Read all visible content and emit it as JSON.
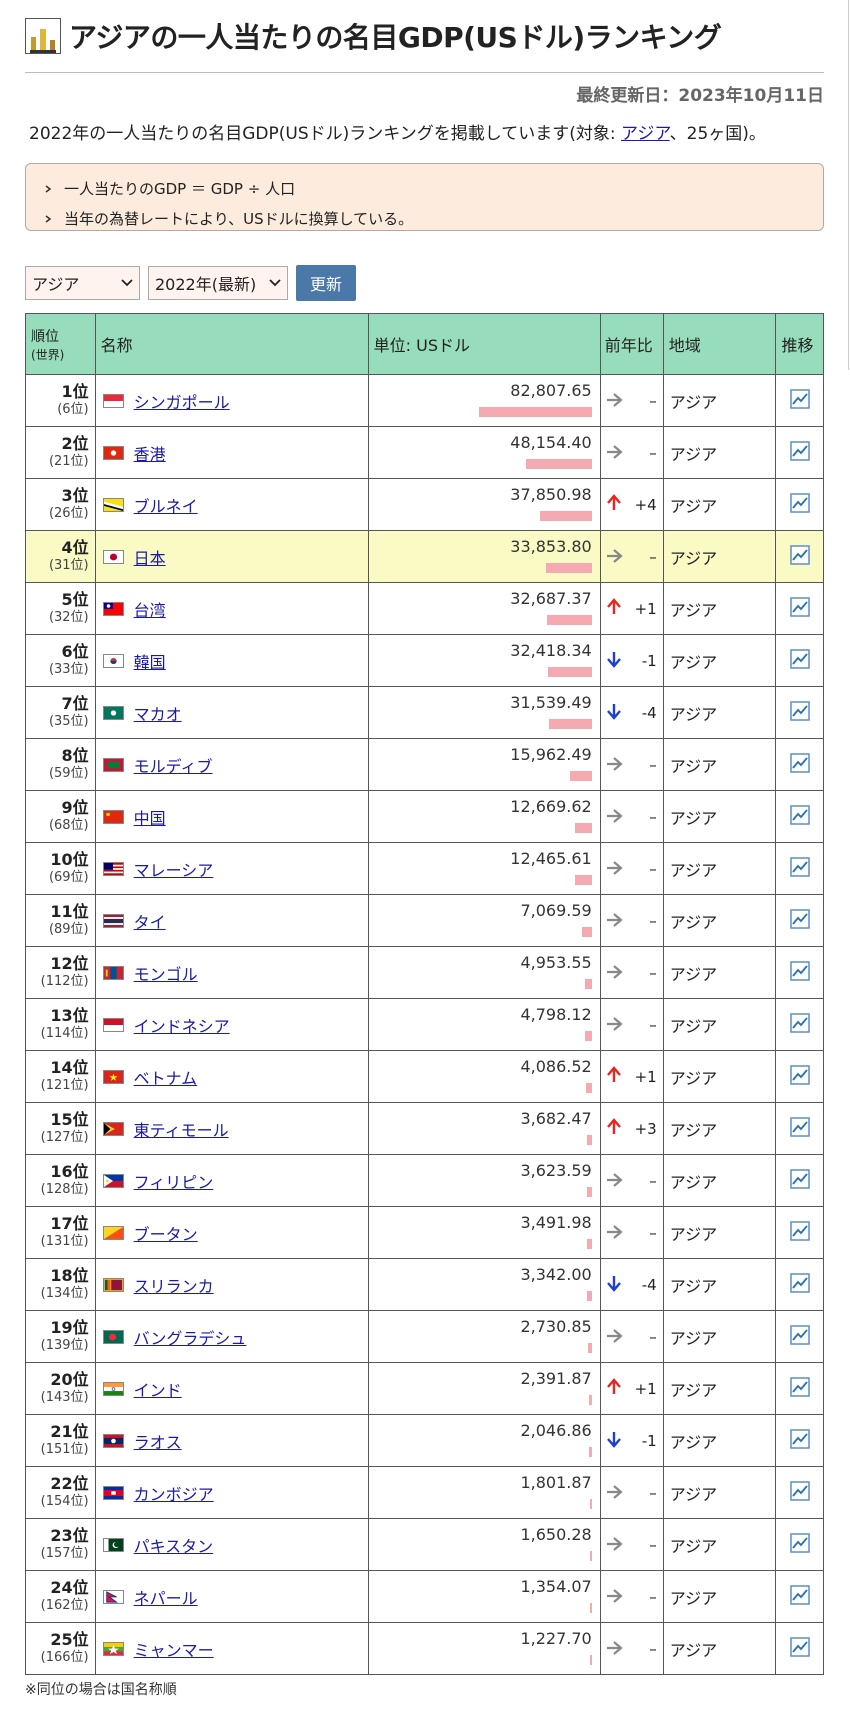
{
  "page": {
    "title": "アジアの一人当たりの名目GDP(USドル)ランキング",
    "updated": "最終更新日：2023年10月11日",
    "desc_prefix": "2022年の一人当たりの名目GDP(USドル)ランキングを掲載しています(対象: ",
    "desc_link": "アジア",
    "desc_suffix": "、25ヶ国)。",
    "notes": [
      "一人当たりのGDP ＝ GDP ÷ 人口",
      "当年の為替レートにより、USドルに換算している。"
    ],
    "footnote": "※同位の場合は国名称順"
  },
  "controls": {
    "region_select": "アジア",
    "year_select": "2022年(最新)",
    "update_button": "更新"
  },
  "table": {
    "headers": {
      "rank": "順位",
      "rank_sub": "(世界)",
      "name": "名称",
      "unit": "単位: USドル",
      "change": "前年比",
      "region": "地域",
      "trend": "推移"
    },
    "rows": [
      {
        "rank": "1位",
        "world": "(6位)",
        "name": "シンガポール",
        "value": "82,807.65",
        "dir": "flat",
        "change": "–",
        "region": "アジア",
        "flag": "sg"
      },
      {
        "rank": "2位",
        "world": "(21位)",
        "name": "香港",
        "value": "48,154.40",
        "dir": "flat",
        "change": "–",
        "region": "アジア",
        "flag": "hk"
      },
      {
        "rank": "3位",
        "world": "(26位)",
        "name": "ブルネイ",
        "value": "37,850.98",
        "dir": "up",
        "change": "+4",
        "region": "アジア",
        "flag": "bn"
      },
      {
        "rank": "4位",
        "world": "(31位)",
        "name": "日本",
        "value": "33,853.80",
        "dir": "flat",
        "change": "–",
        "region": "アジア",
        "flag": "jp",
        "highlight": true
      },
      {
        "rank": "5位",
        "world": "(32位)",
        "name": "台湾",
        "value": "32,687.37",
        "dir": "up",
        "change": "+1",
        "region": "アジア",
        "flag": "tw"
      },
      {
        "rank": "6位",
        "world": "(33位)",
        "name": "韓国",
        "value": "32,418.34",
        "dir": "down",
        "change": "-1",
        "region": "アジア",
        "flag": "kr"
      },
      {
        "rank": "7位",
        "world": "(35位)",
        "name": "マカオ",
        "value": "31,539.49",
        "dir": "down",
        "change": "-4",
        "region": "アジア",
        "flag": "mo"
      },
      {
        "rank": "8位",
        "world": "(59位)",
        "name": "モルディブ",
        "value": "15,962.49",
        "dir": "flat",
        "change": "–",
        "region": "アジア",
        "flag": "mv"
      },
      {
        "rank": "9位",
        "world": "(68位)",
        "name": "中国",
        "value": "12,669.62",
        "dir": "flat",
        "change": "–",
        "region": "アジア",
        "flag": "cn"
      },
      {
        "rank": "10位",
        "world": "(69位)",
        "name": "マレーシア",
        "value": "12,465.61",
        "dir": "flat",
        "change": "–",
        "region": "アジア",
        "flag": "my"
      },
      {
        "rank": "11位",
        "world": "(89位)",
        "name": "タイ",
        "value": "7,069.59",
        "dir": "flat",
        "change": "–",
        "region": "アジア",
        "flag": "th"
      },
      {
        "rank": "12位",
        "world": "(112位)",
        "name": "モンゴル",
        "value": "4,953.55",
        "dir": "flat",
        "change": "–",
        "region": "アジア",
        "flag": "mn"
      },
      {
        "rank": "13位",
        "world": "(114位)",
        "name": "インドネシア",
        "value": "4,798.12",
        "dir": "flat",
        "change": "–",
        "region": "アジア",
        "flag": "id"
      },
      {
        "rank": "14位",
        "world": "(121位)",
        "name": "ベトナム",
        "value": "4,086.52",
        "dir": "up",
        "change": "+1",
        "region": "アジア",
        "flag": "vn"
      },
      {
        "rank": "15位",
        "world": "(127位)",
        "name": "東ティモール",
        "value": "3,682.47",
        "dir": "up",
        "change": "+3",
        "region": "アジア",
        "flag": "tl"
      },
      {
        "rank": "16位",
        "world": "(128位)",
        "name": "フィリピン",
        "value": "3,623.59",
        "dir": "flat",
        "change": "–",
        "region": "アジア",
        "flag": "ph"
      },
      {
        "rank": "17位",
        "world": "(131位)",
        "name": "ブータン",
        "value": "3,491.98",
        "dir": "flat",
        "change": "–",
        "region": "アジア",
        "flag": "bt"
      },
      {
        "rank": "18位",
        "world": "(134位)",
        "name": "スリランカ",
        "value": "3,342.00",
        "dir": "down",
        "change": "-4",
        "region": "アジア",
        "flag": "lk"
      },
      {
        "rank": "19位",
        "world": "(139位)",
        "name": "バングラデシュ",
        "value": "2,730.85",
        "dir": "flat",
        "change": "–",
        "region": "アジア",
        "flag": "bd"
      },
      {
        "rank": "20位",
        "world": "(143位)",
        "name": "インド",
        "value": "2,391.87",
        "dir": "up",
        "change": "+1",
        "region": "アジア",
        "flag": "in"
      },
      {
        "rank": "21位",
        "world": "(151位)",
        "name": "ラオス",
        "value": "2,046.86",
        "dir": "down",
        "change": "-1",
        "region": "アジア",
        "flag": "la"
      },
      {
        "rank": "22位",
        "world": "(154位)",
        "name": "カンボジア",
        "value": "1,801.87",
        "dir": "flat",
        "change": "–",
        "region": "アジア",
        "flag": "kh"
      },
      {
        "rank": "23位",
        "world": "(157位)",
        "name": "パキスタン",
        "value": "1,650.28",
        "dir": "flat",
        "change": "–",
        "region": "アジア",
        "flag": "pk"
      },
      {
        "rank": "24位",
        "world": "(162位)",
        "name": "ネパール",
        "value": "1,354.07",
        "dir": "flat",
        "change": "–",
        "region": "アジア",
        "flag": "np"
      },
      {
        "rank": "25位",
        "world": "(166位)",
        "name": "ミャンマー",
        "value": "1,227.70",
        "dir": "flat",
        "change": "–",
        "region": "アジア",
        "flag": "mm"
      }
    ]
  },
  "colors": {
    "header_bg": "#97ddbb",
    "bar": "#f5a9b0",
    "up_arrow": "#e8241f",
    "down_arrow": "#1f3fcf",
    "flat_arrow": "#888888",
    "highlight_row": "#fafac4",
    "link": "#1a1aa6"
  },
  "icons": {
    "title": "trophy-icon",
    "trend": "line-chart-icon",
    "note_bullet": "chevron-right-icon",
    "select_caret": "chevron-down-icon"
  }
}
